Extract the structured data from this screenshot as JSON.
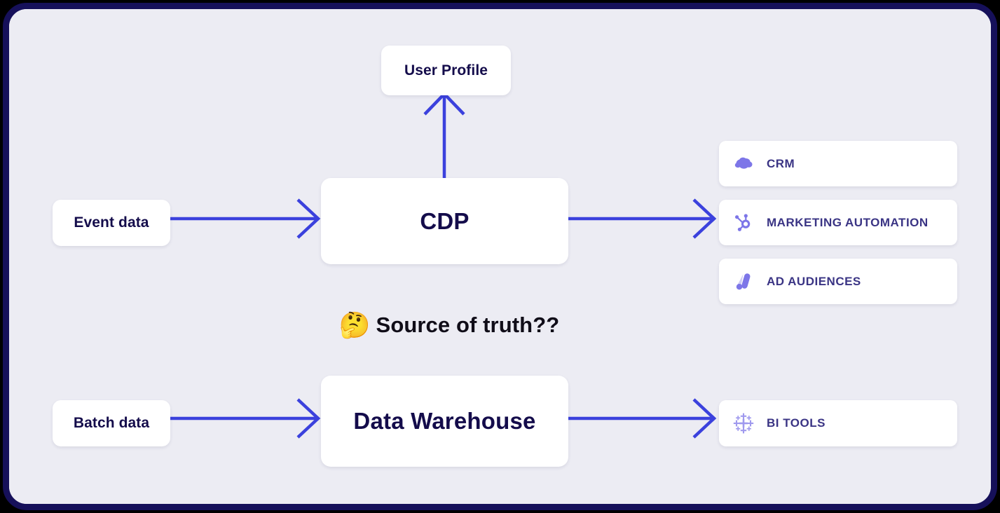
{
  "diagram": {
    "title_visible": false,
    "background_color": "#ececf3",
    "border_color": "#16105a",
    "arrow_color": "#3b41dd",
    "node_text_color": "#140c4b",
    "dest_text_color": "#3a3484",
    "icon_color": "#7d76e8"
  },
  "sources": [
    {
      "id": "event-data",
      "label": "Event data"
    },
    {
      "id": "batch-data",
      "label": "Batch data"
    }
  ],
  "platforms": [
    {
      "id": "cdp",
      "label": "CDP"
    },
    {
      "id": "warehouse",
      "label": "Data Warehouse"
    }
  ],
  "outputs": {
    "user_profile": {
      "label": "User Profile"
    },
    "destinations": [
      {
        "id": "crm",
        "label": "CRM",
        "icon": "salesforce-cloud-icon"
      },
      {
        "id": "marketing-automation",
        "label": "MARKETING AUTOMATION",
        "icon": "hubspot-sprocket-icon"
      },
      {
        "id": "ad-audiences",
        "label": "AD AUDIENCES",
        "icon": "google-ads-icon"
      },
      {
        "id": "bi-tools",
        "label": "BI TOOLS",
        "icon": "tableau-icon"
      }
    ]
  },
  "annotation": {
    "emoji": "🤔",
    "text": "Source of truth??"
  }
}
